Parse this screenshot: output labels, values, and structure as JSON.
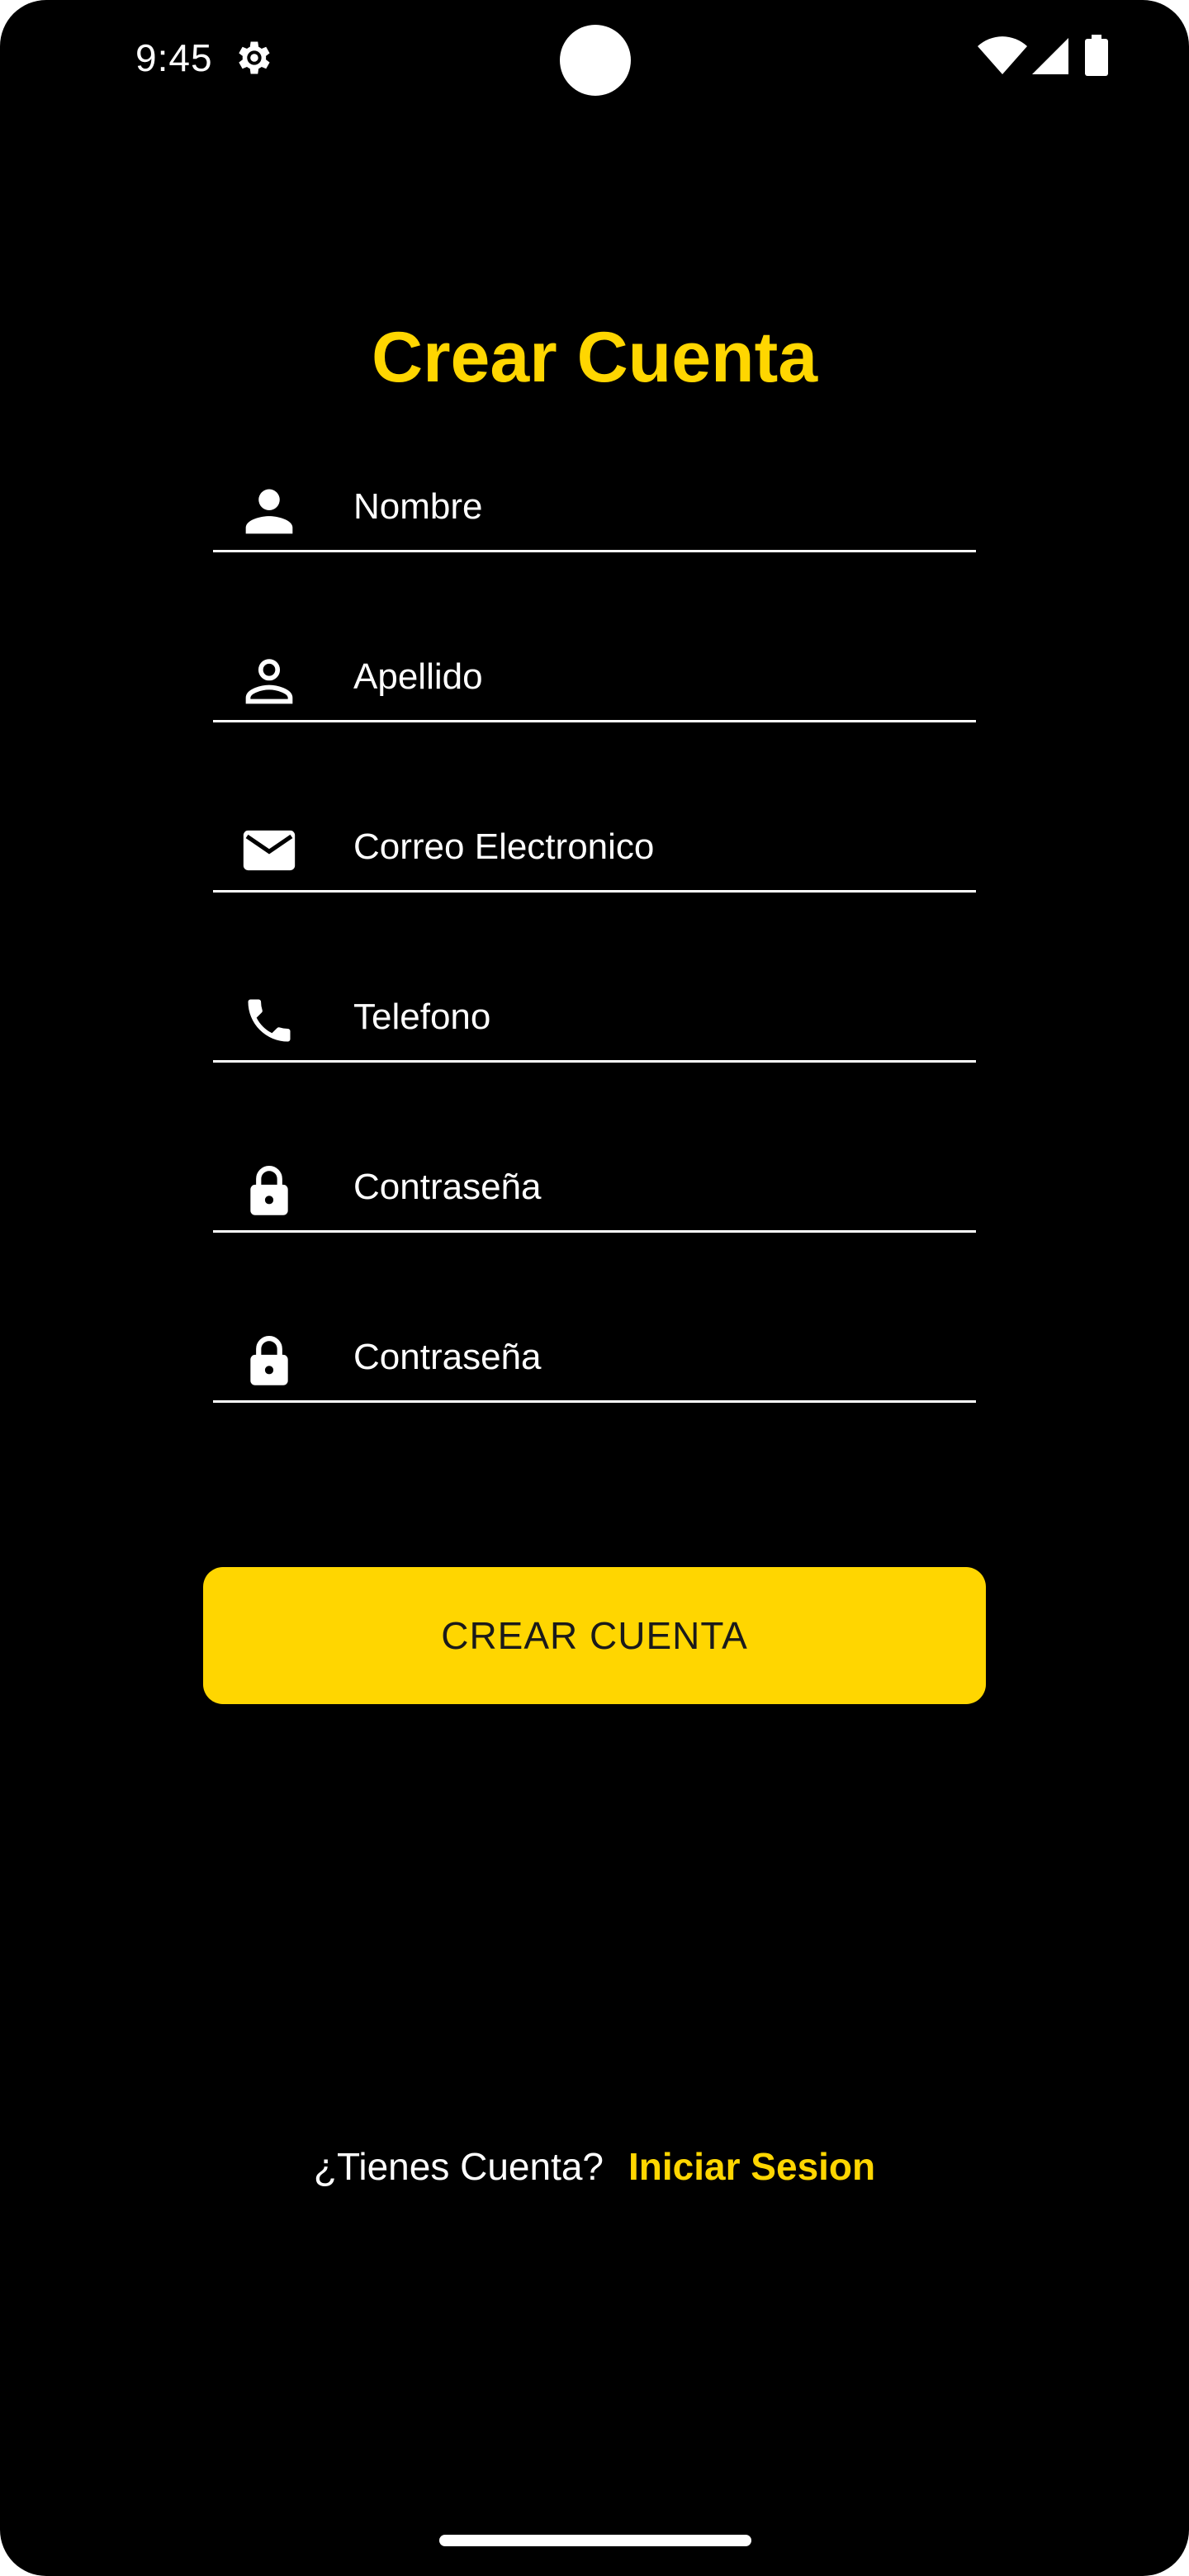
{
  "status_bar": {
    "time": "9:45",
    "icons": [
      "gear-icon",
      "wifi-icon",
      "signal-icon",
      "battery-icon"
    ]
  },
  "title": "Crear Cuenta",
  "fields": [
    {
      "icon": "person-icon",
      "placeholder": "Nombre",
      "value": ""
    },
    {
      "icon": "person-outline-icon",
      "placeholder": "Apellido",
      "value": ""
    },
    {
      "icon": "mail-icon",
      "placeholder": "Correo Electronico",
      "value": ""
    },
    {
      "icon": "phone-icon",
      "placeholder": "Telefono",
      "value": ""
    },
    {
      "icon": "lock-icon",
      "placeholder": "Contraseña",
      "value": ""
    },
    {
      "icon": "lock-icon",
      "placeholder": "Contraseña",
      "value": ""
    }
  ],
  "button": {
    "label": "CREAR CUENTA"
  },
  "footer": {
    "question": "¿Tienes Cuenta?",
    "link": "Iniciar Sesion"
  },
  "colors": {
    "accent": "#ffd600",
    "background": "#000000",
    "text": "#ffffff"
  }
}
